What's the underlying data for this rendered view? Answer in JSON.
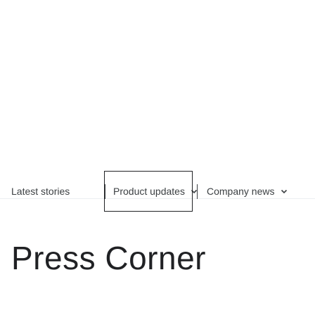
{
  "nav": {
    "items": [
      {
        "label": "Latest stories",
        "icon": null
      },
      {
        "label": "Product updates",
        "icon": "chevron-down-icon"
      },
      {
        "label": "Company news",
        "icon": "chevron-down-icon"
      }
    ],
    "focused_index": 1
  },
  "page": {
    "title": "Press Corner"
  },
  "colors": {
    "text": "#3c4043",
    "title": "#202124",
    "focus_border": "#202124",
    "divider": "#eceff1"
  }
}
